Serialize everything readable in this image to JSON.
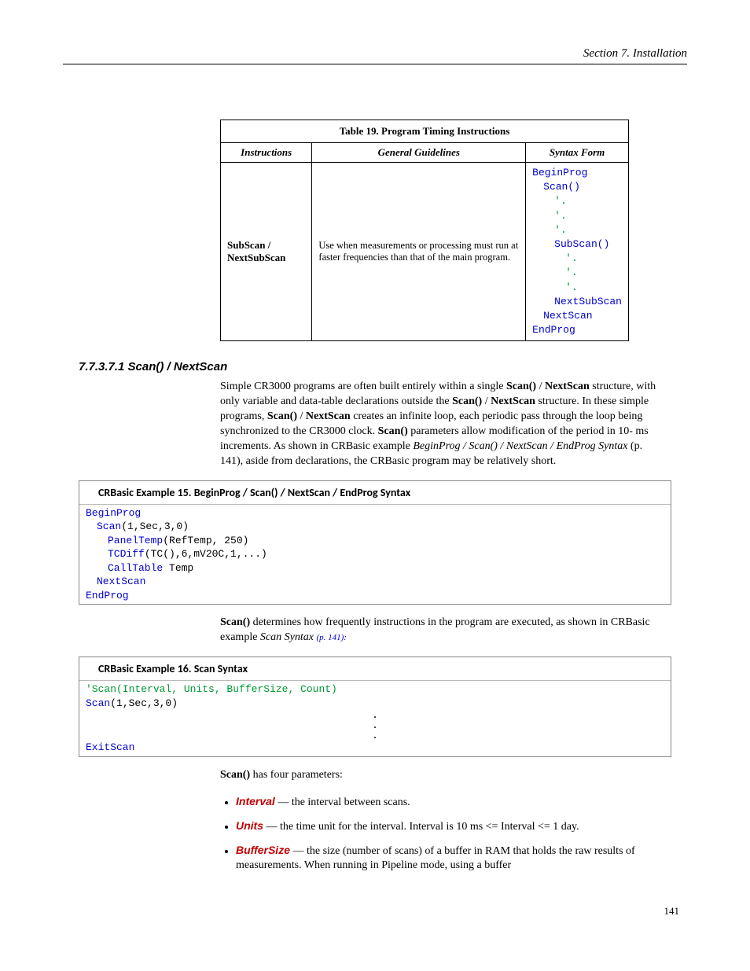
{
  "header": "Section 7.  Installation",
  "table": {
    "caption": "Table 19. Program Timing Instructions",
    "headers": [
      "Instructions",
      "General Guidelines",
      "Syntax Form"
    ],
    "row": {
      "instructions_label": "SubScan / NextSubScan",
      "guidelines": "Use when measurements or processing must run at faster frequencies than that of the main program.",
      "code": {
        "l1": "BeginProg",
        "l2": "Scan()",
        "dot": "'.",
        "l3": "SubScan()",
        "l4": "NextSubScan",
        "l5": "NextScan",
        "l6": "EndProg"
      }
    }
  },
  "section_heading": "7.7.3.7.1 Scan() / NextScan",
  "para1_parts": {
    "p1": "Simple CR3000 programs are often built entirely within a single ",
    "b1": "Scan()",
    "p2": " / ",
    "b2": "NextScan",
    "p3": " structure, with only variable and data-table declarations outside the ",
    "b3": "Scan()",
    "p4": " / ",
    "b4": "NextScan",
    "p5": " structure. In these simple programs, ",
    "b5": "Scan()",
    "p6": " / ",
    "b6": "NextScan",
    "p7": " creates an infinite loop, each periodic pass through the loop being synchronized to the CR3000 clock. ",
    "b7": "Scan()",
    "p8": " parameters allow modification of the period in 10- ms increments. As shown in CRBasic example ",
    "i1": "BeginProg / Scan() / NextScan / EndProg Syntax",
    "p9": " (p. 141), aside from declarations, the CRBasic program may be relatively short."
  },
  "ex15": {
    "title": "CRBasic Example 15.    BeginProg / Scan() / NextScan / EndProg Syntax",
    "lines": {
      "l1": "BeginProg",
      "l2a": "Scan",
      "l2b": "(1,Sec,3,0)",
      "l3a": "PanelTemp",
      "l3b": "(RefTemp, 250)",
      "l4a": "TCDiff",
      "l4b": "(TC(),6,mV20C,1,...)",
      "l5a": "CallTable",
      "l5b": " Temp",
      "l6": "NextScan",
      "l7": "EndProg"
    }
  },
  "para2_parts": {
    "b1": "Scan()",
    "p1": " determines how frequently instructions in the program are executed, as shown in CRBasic example ",
    "i1": "Scan Syntax ",
    "ref": "(p. 141):"
  },
  "ex16": {
    "title": "CRBasic Example 16.    Scan Syntax",
    "lines": {
      "c1": "'Scan(Interval, Units, BufferSize, Count)",
      "l2a": "Scan",
      "l2b": "(1,Sec,3,0)",
      "dot": ".",
      "l3": "ExitScan"
    }
  },
  "para3_parts": {
    "b1": "Scan()",
    "p1": " has four parameters:"
  },
  "bullets": {
    "b1_param": "Interval",
    "b1_text": " — the interval between scans.",
    "b2_param": "Units",
    "b2_text": " — the time unit for the interval. Interval is 10 ms <= Interval <= 1 day.",
    "b3_param": "BufferSize",
    "b3_text": " — the size (number of scans) of a buffer in RAM that holds the raw results of measurements. When running in Pipeline mode, using a buffer"
  },
  "pagenum": "141"
}
